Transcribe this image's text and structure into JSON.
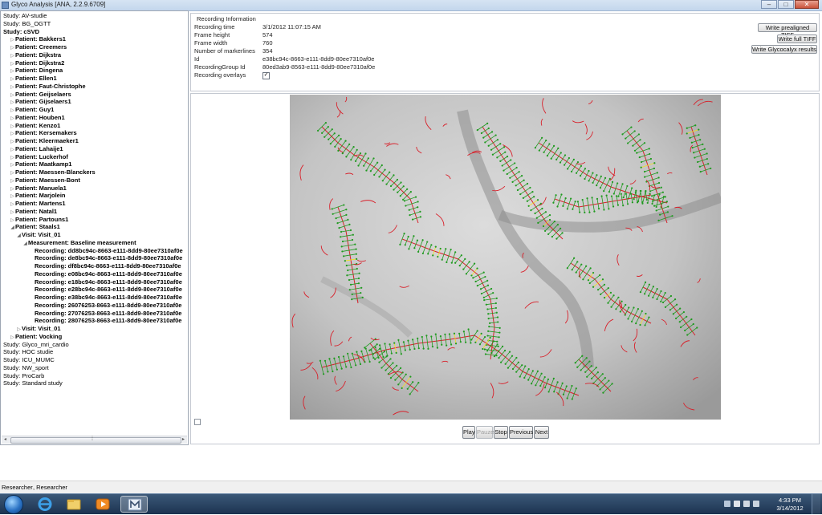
{
  "window": {
    "title": "Glyco Analysis [ANA, 2.2.9.6709]",
    "controls": [
      "–",
      "□",
      "✕"
    ]
  },
  "tree": {
    "nodes": [
      {
        "label": "Study: AV-studie",
        "level": 0,
        "toggle": "",
        "bold": false
      },
      {
        "label": "Study: BG_OGTT",
        "level": 0,
        "toggle": "",
        "bold": false
      },
      {
        "label": "Study: cSVD",
        "level": 0,
        "toggle": "",
        "bold": true
      },
      {
        "label": "Patient: Bakkers1",
        "level": 1,
        "toggle": "▷",
        "bold": true
      },
      {
        "label": "Patient: Creemers",
        "level": 1,
        "toggle": "▷",
        "bold": true
      },
      {
        "label": "Patient: Dijkstra",
        "level": 1,
        "toggle": "▷",
        "bold": true
      },
      {
        "label": "Patient: Dijkstra2",
        "level": 1,
        "toggle": "▷",
        "bold": true
      },
      {
        "label": "Patient: Dingena",
        "level": 1,
        "toggle": "▷",
        "bold": true
      },
      {
        "label": "Patient: Ellen1",
        "level": 1,
        "toggle": "▷",
        "bold": true
      },
      {
        "label": "Patient: Faut-Christophe",
        "level": 1,
        "toggle": "▷",
        "bold": true
      },
      {
        "label": "Patient: Geijselaers",
        "level": 1,
        "toggle": "▷",
        "bold": true
      },
      {
        "label": "Patient: Gijselaers1",
        "level": 1,
        "toggle": "▷",
        "bold": true
      },
      {
        "label": "Patient: Guy1",
        "level": 1,
        "toggle": "▷",
        "bold": true
      },
      {
        "label": "Patient: Houben1",
        "level": 1,
        "toggle": "▷",
        "bold": true
      },
      {
        "label": "Patient: Kenzo1",
        "level": 1,
        "toggle": "▷",
        "bold": true
      },
      {
        "label": "Patient: Kersemakers",
        "level": 1,
        "toggle": "▷",
        "bold": true
      },
      {
        "label": "Patient: Kleermaeker1",
        "level": 1,
        "toggle": "▷",
        "bold": true
      },
      {
        "label": "Patient: Lahaije1",
        "level": 1,
        "toggle": "▷",
        "bold": true
      },
      {
        "label": "Patient: Luckerhof",
        "level": 1,
        "toggle": "▷",
        "bold": true
      },
      {
        "label": "Patient: Maatkamp1",
        "level": 1,
        "toggle": "▷",
        "bold": true
      },
      {
        "label": "Patient: Maessen-Blanckers",
        "level": 1,
        "toggle": "▷",
        "bold": true
      },
      {
        "label": "Patient: Maessen-Bont",
        "level": 1,
        "toggle": "▷",
        "bold": true
      },
      {
        "label": "Patient: Manuela1",
        "level": 1,
        "toggle": "▷",
        "bold": true
      },
      {
        "label": "Patient: Marjolein",
        "level": 1,
        "toggle": "▷",
        "bold": true
      },
      {
        "label": "Patient: Martens1",
        "level": 1,
        "toggle": "▷",
        "bold": true
      },
      {
        "label": "Patient: Natal1",
        "level": 1,
        "toggle": "▷",
        "bold": true
      },
      {
        "label": "Patient: Partouns1",
        "level": 1,
        "toggle": "▷",
        "bold": true
      },
      {
        "label": "Patient: Staals1",
        "level": 1,
        "toggle": "◢",
        "bold": true
      },
      {
        "label": "Visit: Visit_01",
        "level": 2,
        "toggle": "◢",
        "bold": true
      },
      {
        "label": "Measurement: Baseline measurement",
        "level": 3,
        "toggle": "◢",
        "bold": true
      },
      {
        "label": "Recording: dd8bc94c-8663-e111-8dd9-80ee7310af0e",
        "level": 4,
        "toggle": "",
        "bold": true
      },
      {
        "label": "Recording: de8bc94c-8663-e111-8dd9-80ee7310af0e",
        "level": 4,
        "toggle": "",
        "bold": true
      },
      {
        "label": "Recording: df8bc94c-8663-e111-8dd9-80ee7310af0e",
        "level": 4,
        "toggle": "",
        "bold": true
      },
      {
        "label": "Recording: e08bc94c-8663-e111-8dd9-80ee7310af0e",
        "level": 4,
        "toggle": "",
        "bold": true
      },
      {
        "label": "Recording: e18bc94c-8663-e111-8dd9-80ee7310af0e",
        "level": 4,
        "toggle": "",
        "bold": true
      },
      {
        "label": "Recording: e28bc94c-8663-e111-8dd9-80ee7310af0e",
        "level": 4,
        "toggle": "",
        "bold": true
      },
      {
        "label": "Recording: e38bc94c-8663-e111-8dd9-80ee7310af0e",
        "level": 4,
        "toggle": "",
        "bold": true
      },
      {
        "label": "Recording: 26076253-8663-e111-8dd9-80ee7310af0e",
        "level": 4,
        "toggle": "",
        "bold": true
      },
      {
        "label": "Recording: 27076253-8663-e111-8dd9-80ee7310af0e",
        "level": 4,
        "toggle": "",
        "bold": true
      },
      {
        "label": "Recording: 28076253-8663-e111-8dd9-80ee7310af0e",
        "level": 4,
        "toggle": "",
        "bold": true
      },
      {
        "label": "Visit: Visit_01",
        "level": 2,
        "toggle": "▷",
        "bold": true
      },
      {
        "label": "Patient: Vocking",
        "level": 1,
        "toggle": "▷",
        "bold": true
      },
      {
        "label": "Study: Glyco_mri_cardio",
        "level": 0,
        "toggle": "",
        "bold": false
      },
      {
        "label": "Study: HOC studie",
        "level": 0,
        "toggle": "",
        "bold": false
      },
      {
        "label": "Study: ICU_MUMC",
        "level": 0,
        "toggle": "",
        "bold": false
      },
      {
        "label": "Study: NW_sport",
        "level": 0,
        "toggle": "",
        "bold": false
      },
      {
        "label": "Study: ProCarb",
        "level": 0,
        "toggle": "",
        "bold": false
      },
      {
        "label": "Study: Standard study",
        "level": 0,
        "toggle": "",
        "bold": false
      }
    ],
    "scroll_left": "◂",
    "scroll_right": "▸",
    "scroll_grip": "⁞"
  },
  "info": {
    "title": "Recording Information",
    "rows": [
      {
        "label": "Recording time",
        "value": "3/1/2012 11:07:15 AM"
      },
      {
        "label": "Frame height",
        "value": "574"
      },
      {
        "label": "Frame width",
        "value": "760"
      },
      {
        "label": "Number of markerlines",
        "value": "354"
      },
      {
        "label": "Id",
        "value": "e38bc94c-8663-e111-8dd9-80ee7310af0e"
      },
      {
        "label": "RecordingGroup Id",
        "value": "80ed3ab9-8563-e111-8dd9-80ee7310af0e"
      }
    ],
    "overlays_label": "Recording overlays",
    "overlays_checked": true,
    "check_mark": "✓"
  },
  "actions": {
    "prealigned": "Write prealigned TIFF",
    "full": "Write full TIFF",
    "glycocalyx": "Write Glycocalyx results"
  },
  "playback": {
    "play": "Play",
    "pause": "Pauze",
    "stop": "Stop",
    "previous": "Previous",
    "next": "Next",
    "pause_enabled": false
  },
  "overlay_colors": {
    "vessel": "#d8202a",
    "marker": "#1f9a1f",
    "flagged": "#f2e01c"
  },
  "status": {
    "left": "Researcher",
    "right": ", Researcher"
  },
  "taskbar": {
    "apps": [
      "start-orb",
      "internet-explorer-icon",
      "file-explorer-icon",
      "media-player-icon",
      "glyco-analysis-icon"
    ],
    "time": "4:33 PM",
    "date": "3/14/2012"
  }
}
